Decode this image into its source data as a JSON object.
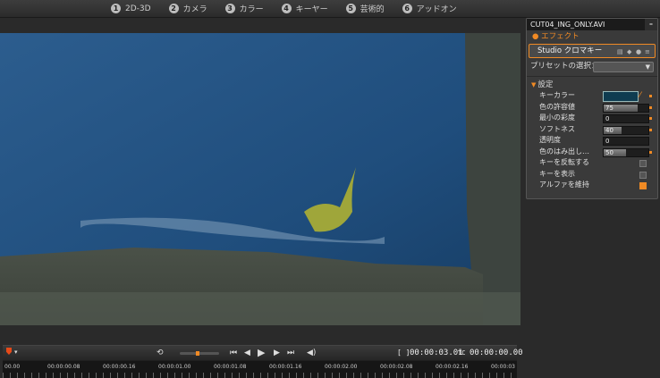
{
  "tabs": [
    {
      "num": "1",
      "label": "2D-3D"
    },
    {
      "num": "2",
      "label": "カメラ"
    },
    {
      "num": "3",
      "label": "カラー"
    },
    {
      "num": "4",
      "label": "キーヤー"
    },
    {
      "num": "5",
      "label": "芸術的"
    },
    {
      "num": "6",
      "label": "アッドオン"
    }
  ],
  "panel": {
    "title": "CUT04_ING_ONLY.AVI",
    "section": "エフェクト",
    "effect_name": "Studio クロマキー",
    "preset_label": "プリセットの選択：",
    "settings_label": "設定",
    "rows": {
      "key_color": "キーカラー",
      "tolerance": {
        "label": "色の許容値",
        "value": "75",
        "fraction": 0.75
      },
      "min_sat": {
        "label": "最小の彩度",
        "value": "0"
      },
      "softness": {
        "label": "ソフトネス",
        "value": "40",
        "fraction": 0.4
      },
      "transparency": {
        "label": "透明度",
        "value": "0"
      },
      "spill": {
        "label": "色のはみ出し…",
        "value": "50",
        "fraction": 0.5
      },
      "invert": "キーを反転する",
      "show_key": "キーを表示",
      "keep_alpha": "アルファを維持"
    }
  },
  "transport": {
    "duration": "00:00:03.01",
    "tc_label": "TC",
    "tc": "00:00:00.00"
  },
  "ruler": [
    "00.00",
    "00:00:00.08",
    "00:00:00.16",
    "00:00:01.00",
    "00:00:01.08",
    "00:00:01.16",
    "00:00:02.00",
    "00:00:02.08",
    "00:00:02.16",
    "00:00:03"
  ]
}
